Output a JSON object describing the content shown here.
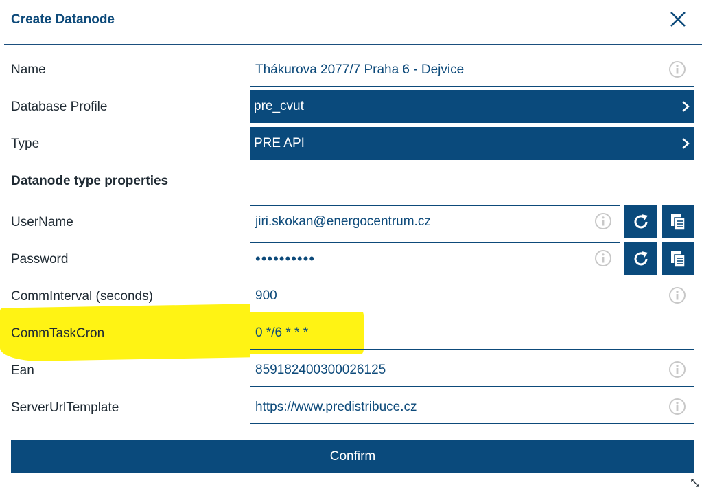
{
  "dialog": {
    "title": "Create Datanode",
    "close_icon": "close-icon"
  },
  "fields": {
    "name": {
      "label": "Name",
      "value": "Thákurova 2077/7 Praha 6 - Dejvice"
    },
    "database_profile": {
      "label": "Database Profile",
      "value": "pre_cvut"
    },
    "type": {
      "label": "Type",
      "value": "PRE API"
    }
  },
  "section_title": "Datanode type properties",
  "properties": {
    "username": {
      "label": "UserName",
      "value": "jiri.skokan@energocentrum.cz"
    },
    "password": {
      "label": "Password",
      "value": "••••••••••"
    },
    "comm_interval": {
      "label": "CommInterval (seconds)",
      "value": "900"
    },
    "comm_task_cron": {
      "label": "CommTaskCron",
      "value": "0 */6 * * *"
    },
    "ean": {
      "label": "Ean",
      "value": "859182400300026125"
    },
    "server_url_template": {
      "label": "ServerUrlTemplate",
      "value": "https://www.predistribuce.cz"
    }
  },
  "buttons": {
    "confirm": "Confirm"
  },
  "colors": {
    "primary": "#0a4a7c",
    "text_accent": "#0d4a7a",
    "highlight": "#fff200",
    "info_icon": "#c8c8c8"
  },
  "icons": [
    "close-icon",
    "info-icon",
    "chevron-right-icon",
    "refresh-icon",
    "copy-icon",
    "resize-handle-icon"
  ]
}
